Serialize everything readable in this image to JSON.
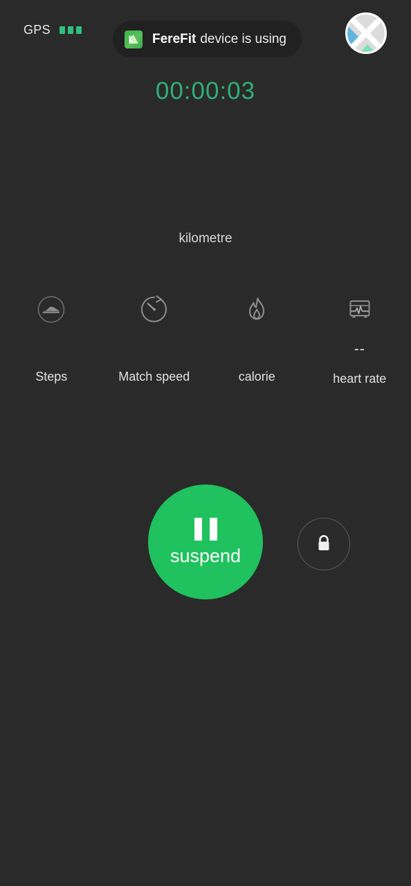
{
  "status": {
    "gps_label": "GPS",
    "gps_bar_count": 3,
    "gps_bar_color": "#2fc07d"
  },
  "toast": {
    "app_icon": "ferefit-app-icon",
    "app_name": "FereFit",
    "message": "device is using"
  },
  "map_badge": {
    "icon": "map-compass-icon",
    "colors": {
      "blue": "#62b4dd",
      "teal": "#7fe0b4",
      "gray": "#dcdcdc",
      "outline": "#ffffff"
    }
  },
  "workout": {
    "timer": "00:00:03",
    "timer_color": "#2fae7d",
    "distance_value": "",
    "distance_unit": "kilometre"
  },
  "stats": [
    {
      "icon": "shoe-steps-icon",
      "value": "",
      "label": "Steps"
    },
    {
      "icon": "stopwatch-pace-icon",
      "value": "",
      "label": "Match speed"
    },
    {
      "icon": "flame-calorie-icon",
      "value": "",
      "label": "calorie"
    },
    {
      "icon": "heart-rate-monitor-icon",
      "value": "--",
      "label": "heart rate"
    }
  ],
  "controls": {
    "suspend_label": "suspend",
    "suspend_icon": "pause-icon",
    "suspend_color": "#1fc25e",
    "lock_icon": "lock-icon"
  }
}
